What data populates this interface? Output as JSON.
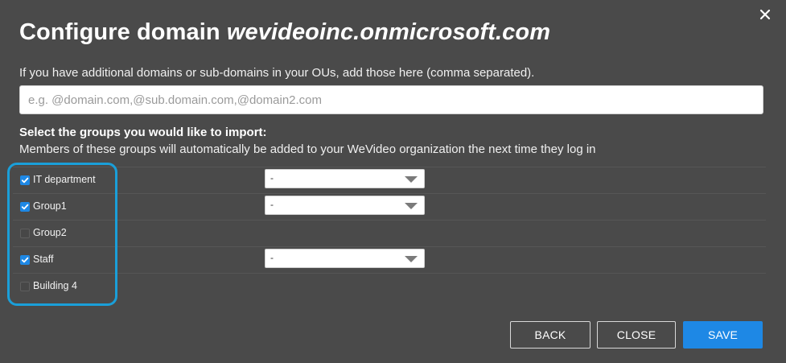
{
  "dialog": {
    "title_prefix": "Configure domain ",
    "title_domain": "wevideoinc.onmicrosoft.com",
    "close_icon": "close-icon"
  },
  "domains": {
    "hint": "If you have additional domains or sub-domains in your OUs, add those here (comma separated).",
    "placeholder": "e.g. @domain.com,@sub.domain.com,@domain2.com",
    "value": ""
  },
  "groups": {
    "heading": "Select the groups you would like to import:",
    "subheading": "Members of these groups will automatically be added to your WeVideo organization the next time they log in",
    "items": [
      {
        "label": "IT department",
        "checked": true,
        "role": "-"
      },
      {
        "label": "Group1",
        "checked": true,
        "role": "-"
      },
      {
        "label": "Group2",
        "checked": false,
        "role": null
      },
      {
        "label": "Staff",
        "checked": true,
        "role": "-"
      },
      {
        "label": "Building 4",
        "checked": false,
        "role": null
      }
    ]
  },
  "buttons": {
    "back": "BACK",
    "close": "CLOSE",
    "save": "SAVE"
  },
  "colors": {
    "background": "#4a4a4a",
    "accent": "#1e88e5",
    "highlight": "#1a9fd9"
  }
}
